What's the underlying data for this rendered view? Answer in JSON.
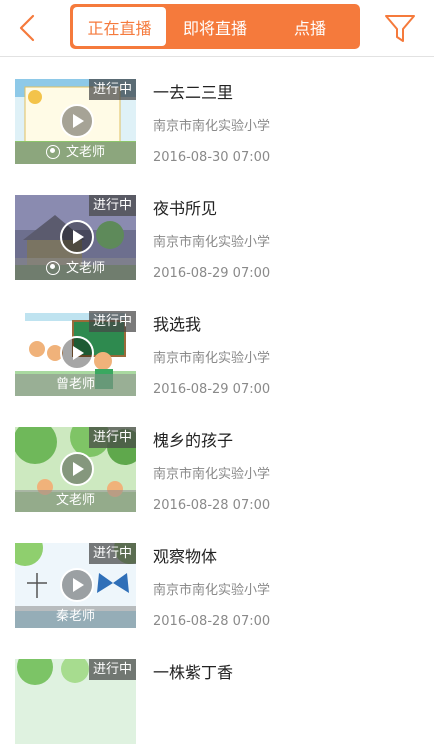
{
  "header": {
    "tabs": [
      {
        "label": "正在直播",
        "active": true
      },
      {
        "label": "即将直播",
        "active": false
      },
      {
        "label": "点播",
        "active": false
      }
    ]
  },
  "colors": {
    "accent": "#f57a3c",
    "text": "#222222",
    "muted": "#8a8a8a"
  },
  "icons": {
    "back": "chevron-left-icon",
    "filter": "filter-funnel-icon",
    "play": "play-icon",
    "user": "user-icon"
  },
  "lessons": [
    {
      "title": "一去二三里",
      "school": "南京市南化实验小学",
      "datetime": "2016-08-30 07:00",
      "status": "进行中",
      "teacher": "文老师",
      "teacher_icon": true
    },
    {
      "title": "夜书所见",
      "school": "南京市南化实验小学",
      "datetime": "2016-08-29 07:00",
      "status": "进行中",
      "teacher": "文老师",
      "teacher_icon": true
    },
    {
      "title": "我选我",
      "school": "南京市南化实验小学",
      "datetime": "2016-08-29 07:00",
      "status": "进行中",
      "teacher": "曾老师",
      "teacher_icon": false
    },
    {
      "title": "槐乡的孩子",
      "school": "南京市南化实验小学",
      "datetime": "2016-08-28 07:00",
      "status": "进行中",
      "teacher": "文老师",
      "teacher_icon": false
    },
    {
      "title": "观察物体",
      "school": "南京市南化实验小学",
      "datetime": "2016-08-28 07:00",
      "status": "进行中",
      "teacher": "秦老师",
      "teacher_icon": false
    },
    {
      "title": "一株紫丁香",
      "status": "进行中"
    }
  ]
}
